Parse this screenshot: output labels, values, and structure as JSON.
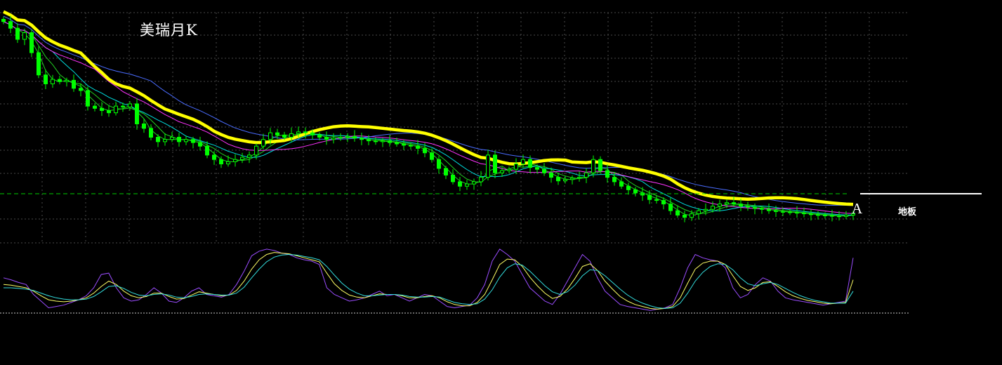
{
  "title": "美瑞月K",
  "annotations": {
    "point": "A",
    "floor": "地板"
  },
  "colors": {
    "background": "#000000",
    "grid": "#4a4a4a",
    "candle": "#00ff00",
    "ma_yellow": "#ffff00",
    "ma_blue": "#4a6cff",
    "ma_magenta": "#ff33ff",
    "ma_cyan": "#00dddd",
    "ma_green": "#22cc22",
    "ind_purple": "#9b4dff",
    "ind_yellow": "#ffff66",
    "ind_cyan": "#33dddd",
    "floor_line": "#ffffff",
    "support_line": "#00cc00"
  },
  "chart_data": [
    {
      "type": "candlestick",
      "title": "美瑞月K",
      "grid": true,
      "close": [
        1000,
        985,
        960,
        975,
        930,
        880,
        860,
        870,
        865,
        868,
        850,
        845,
        810,
        805,
        800,
        795,
        810,
        808,
        815,
        770,
        760,
        740,
        730,
        735,
        740,
        730,
        735,
        728,
        720,
        700,
        690,
        680,
        685,
        690,
        695,
        700,
        720,
        735,
        750,
        745,
        740,
        748,
        752,
        750,
        745,
        740,
        735,
        738,
        740,
        742,
        738,
        735,
        732,
        730,
        732,
        728,
        725,
        722,
        720,
        715,
        705,
        690,
        670,
        655,
        640,
        630,
        635,
        640,
        650,
        700,
        660,
        665,
        668,
        680,
        690,
        672,
        668,
        660,
        650,
        642,
        645,
        648,
        650,
        660,
        690,
        665,
        650,
        640,
        630,
        622,
        615,
        610,
        600,
        598,
        590,
        575,
        565,
        560,
        568,
        575,
        578,
        585,
        590,
        593,
        590,
        585,
        583,
        580,
        578,
        575,
        573,
        572,
        571,
        570,
        568,
        566,
        565,
        564,
        563,
        562,
        565,
        568
      ],
      "ma_count": 6
    },
    {
      "type": "line",
      "series": [
        {
          "values": [
            55,
            52,
            48,
            45,
            30,
            20,
            10,
            12,
            14,
            18,
            22,
            28,
            40,
            60,
            62,
            40,
            25,
            20,
            22,
            30,
            40,
            32,
            20,
            18,
            25,
            35,
            40,
            30,
            28,
            26,
            30,
            45,
            65,
            88,
            95,
            98,
            96,
            92,
            90,
            85,
            82,
            80,
            75,
            40,
            30,
            25,
            20,
            22,
            25,
            30,
            35,
            28,
            30,
            25,
            20,
            25,
            30,
            28,
            20,
            12,
            10,
            12,
            14,
            25,
            45,
            80,
            98,
            90,
            80,
            60,
            40,
            30,
            20,
            15,
            30,
            50,
            70,
            90,
            80,
            55,
            35,
            25,
            15,
            12,
            10,
            8,
            6,
            8,
            10,
            15,
            40,
            70,
            90,
            85,
            82,
            80,
            70,
            40,
            25,
            30,
            45,
            55,
            50,
            35,
            25,
            22,
            20,
            18,
            16,
            14,
            16,
            18,
            20,
            85
          ]
        },
        {
          "values": [
            45,
            44,
            42,
            40,
            35,
            28,
            22,
            20,
            19,
            20,
            22,
            25,
            32,
            42,
            50,
            45,
            35,
            28,
            25,
            27,
            32,
            32,
            27,
            23,
            24,
            29,
            34,
            32,
            30,
            28,
            29,
            36,
            50,
            68,
            82,
            90,
            93,
            92,
            91,
            88,
            85,
            82,
            79,
            62,
            46,
            36,
            29,
            26,
            25,
            28,
            31,
            30,
            30,
            28,
            25,
            25,
            27,
            28,
            25,
            19,
            15,
            13,
            13,
            18,
            30,
            52,
            75,
            83,
            82,
            72,
            56,
            43,
            32,
            24,
            27,
            38,
            54,
            72,
            76,
            66,
            50,
            38,
            27,
            20,
            15,
            12,
            9,
            8,
            9,
            12,
            25,
            47,
            68,
            77,
            80,
            80,
            75,
            58,
            42,
            36,
            40,
            48,
            49,
            42,
            34,
            28,
            24,
            21,
            19,
            17,
            16,
            17,
            18,
            52
          ]
        },
        {
          "values": [
            40,
            40,
            39,
            38,
            36,
            32,
            28,
            25,
            23,
            22,
            22,
            23,
            27,
            34,
            42,
            43,
            39,
            33,
            29,
            28,
            30,
            31,
            29,
            26,
            25,
            27,
            30,
            31,
            30,
            29,
            29,
            32,
            41,
            55,
            68,
            79,
            86,
            89,
            90,
            89,
            87,
            85,
            82,
            72,
            59,
            47,
            38,
            32,
            28,
            28,
            29,
            30,
            30,
            29,
            27,
            26,
            26,
            27,
            26,
            22,
            18,
            16,
            15,
            16,
            23,
            37,
            56,
            70,
            76,
            74,
            65,
            54,
            43,
            34,
            30,
            34,
            44,
            58,
            67,
            66,
            58,
            48,
            38,
            29,
            22,
            17,
            13,
            10,
            9,
            10,
            17,
            32,
            50,
            63,
            72,
            76,
            75,
            67,
            55,
            46,
            43,
            46,
            48,
            45,
            39,
            33,
            28,
            24,
            21,
            19,
            17,
            17,
            17,
            35
          ]
        }
      ]
    }
  ]
}
